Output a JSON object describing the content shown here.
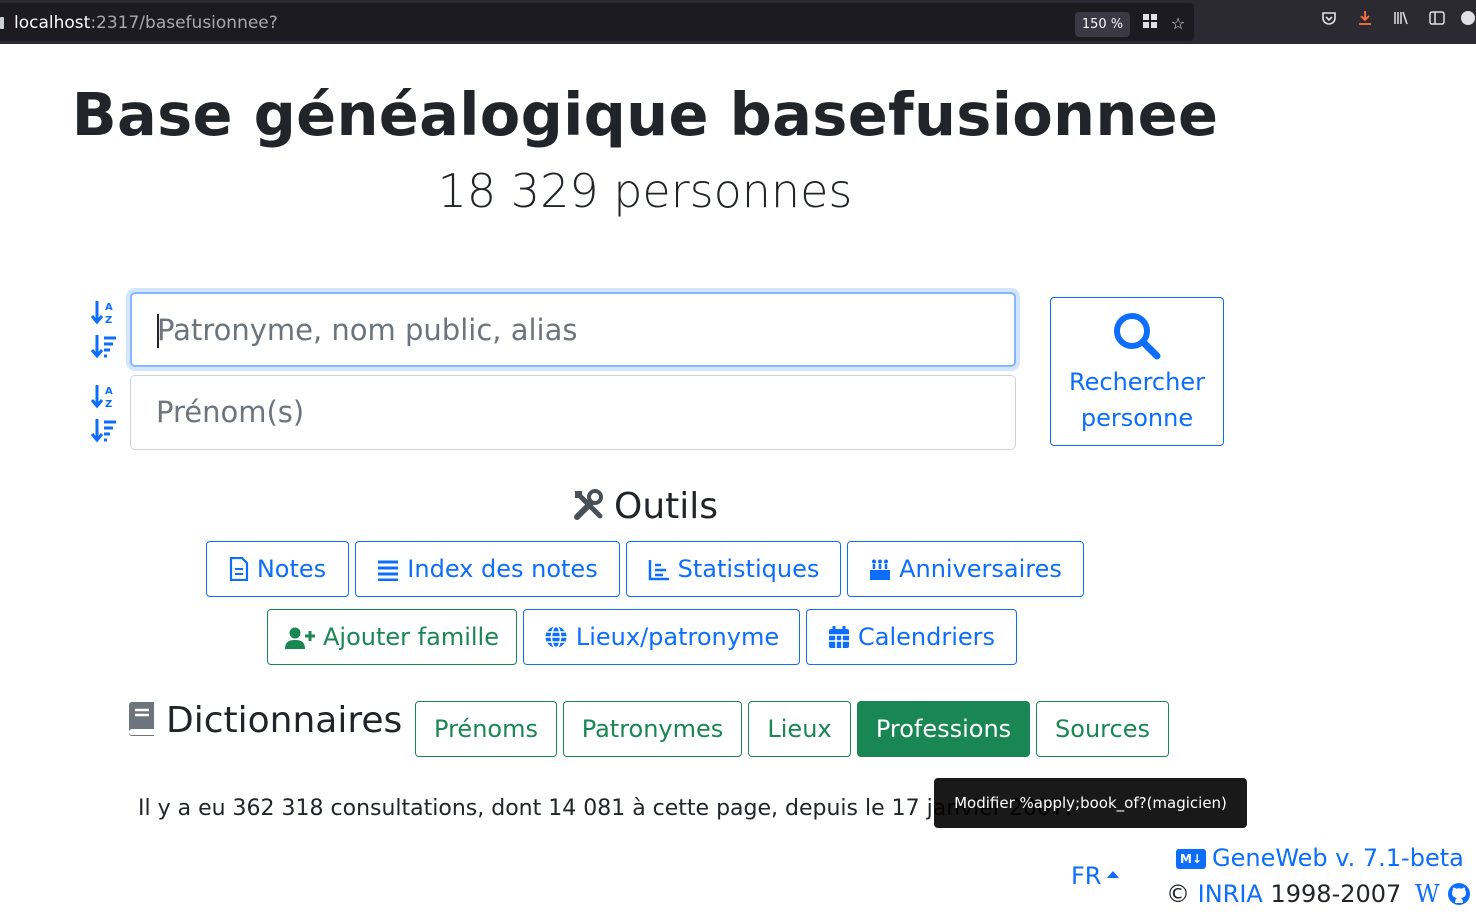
{
  "browser": {
    "url_host": "localhost",
    "url_rest": ":2317/basefusionnee?",
    "zoom": "150 %"
  },
  "header": {
    "title": "Base généalogique basefusionnee",
    "subtitle": "18 329 personnes"
  },
  "search": {
    "surname_placeholder": "Patronyme, nom public, alias",
    "firstname_placeholder": "Prénom(s)",
    "button_line1": "Rechercher",
    "button_line2": "personne"
  },
  "tools": {
    "title": "Outils",
    "row1": [
      {
        "label": "Notes",
        "icon": "file-icon"
      },
      {
        "label": "Index des notes",
        "icon": "list-icon"
      },
      {
        "label": "Statistiques",
        "icon": "chart-icon"
      },
      {
        "label": "Anniversaires",
        "icon": "cake-icon"
      }
    ],
    "row2": [
      {
        "label": "Ajouter famille",
        "icon": "user-plus-icon"
      },
      {
        "label": "Lieux/patronyme",
        "icon": "globe-icon"
      },
      {
        "label": "Calendriers",
        "icon": "calendar-icon"
      }
    ]
  },
  "dictionaries": {
    "title": "Dictionnaires",
    "items": [
      "Prénoms",
      "Patronymes",
      "Lieux",
      "Professions",
      "Sources"
    ],
    "active": "Professions"
  },
  "footer": {
    "visits": "Il y a eu 362 318 consultations, dont 14 081 à cette page, depuis le 17 janvier 2007.",
    "tooltip": "Modifier %apply;book_of?(magicien)",
    "lang": "FR",
    "version": "GeneWeb v. 7.1-beta",
    "copyright_symbol": "©",
    "copyright_org": "INRIA",
    "copyright_years": "1998-2007"
  },
  "colors": {
    "primary": "#0d6efd",
    "success": "#198754"
  }
}
